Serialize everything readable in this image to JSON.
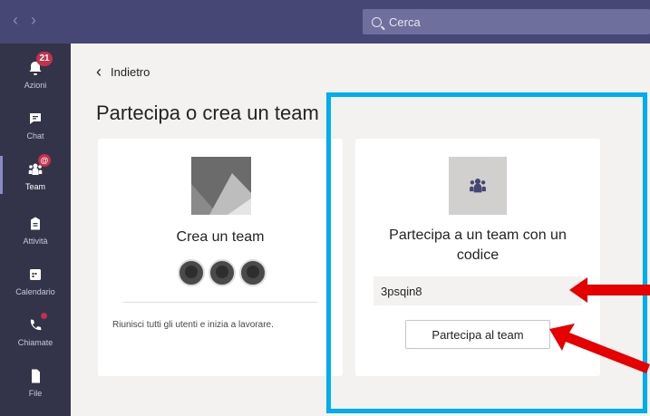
{
  "topbar": {
    "back_arrow": "‹",
    "forward_arrow": "›",
    "search_placeholder": "Cerca"
  },
  "rail": {
    "items": [
      {
        "label": "Azioni",
        "icon": "bell-icon",
        "badge": "21"
      },
      {
        "label": "Chat",
        "icon": "chat-icon"
      },
      {
        "label": "Team",
        "icon": "team-icon",
        "badge": "@"
      },
      {
        "label": "Attività",
        "icon": "assignment-icon"
      },
      {
        "label": "Calendario",
        "icon": "calendar-icon"
      },
      {
        "label": "Chiamate",
        "icon": "phone-icon"
      },
      {
        "label": "File",
        "icon": "file-icon"
      }
    ]
  },
  "main": {
    "back_label": "Indietro",
    "back_icon": "‹",
    "title": "Partecipa o crea un team",
    "create_card": {
      "title": "Crea un team",
      "description": "Riunisci tutti gli utenti e inizia a lavorare."
    },
    "join_card": {
      "title": "Partecipa a un team con un codice",
      "code_value": "3psqin8",
      "button_label": "Partecipa al team"
    }
  },
  "colors": {
    "topbar": "#464775",
    "rail": "#33344a",
    "highlight": "#00aeef",
    "arrow": "#e60000",
    "badge": "#c4314b"
  }
}
